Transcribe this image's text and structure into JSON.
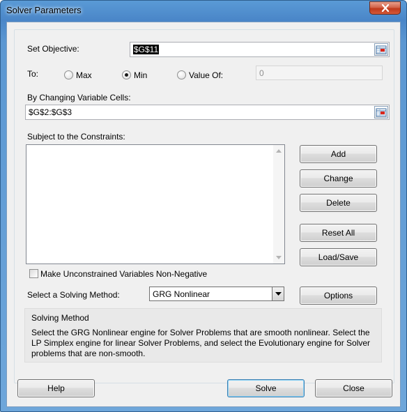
{
  "window": {
    "title": "Solver Parameters"
  },
  "objective": {
    "label": "Set Objective:",
    "value": "$G$11"
  },
  "to": {
    "label": "To:",
    "options": [
      "Max",
      "Min",
      "Value Of:"
    ],
    "selected": "Min",
    "value_of": "0"
  },
  "changing": {
    "label": "By Changing Variable Cells:",
    "value": "$G$2:$G$3"
  },
  "constraints": {
    "label": "Subject to the Constraints:",
    "items": []
  },
  "buttons": {
    "add": "Add",
    "change": "Change",
    "delete": "Delete",
    "reset_all": "Reset All",
    "load_save": "Load/Save",
    "options": "Options",
    "help": "Help",
    "solve": "Solve",
    "close": "Close"
  },
  "nonnegative": {
    "label": "Make Unconstrained Variables Non-Negative",
    "checked": false
  },
  "method": {
    "label": "Select a Solving Method:",
    "value": "GRG Nonlinear"
  },
  "description": {
    "title": "Solving Method",
    "text": "Select the GRG Nonlinear engine for Solver Problems that are smooth nonlinear. Select the LP Simplex engine for linear Solver Problems, and select the Evolutionary engine for Solver problems that are non-smooth."
  },
  "icons": {
    "close": "close-icon",
    "range_select": "range-select-icon",
    "scroll_up": "scroll-up-icon",
    "scroll_down": "scroll-down-icon",
    "dropdown": "chevron-down-icon"
  }
}
